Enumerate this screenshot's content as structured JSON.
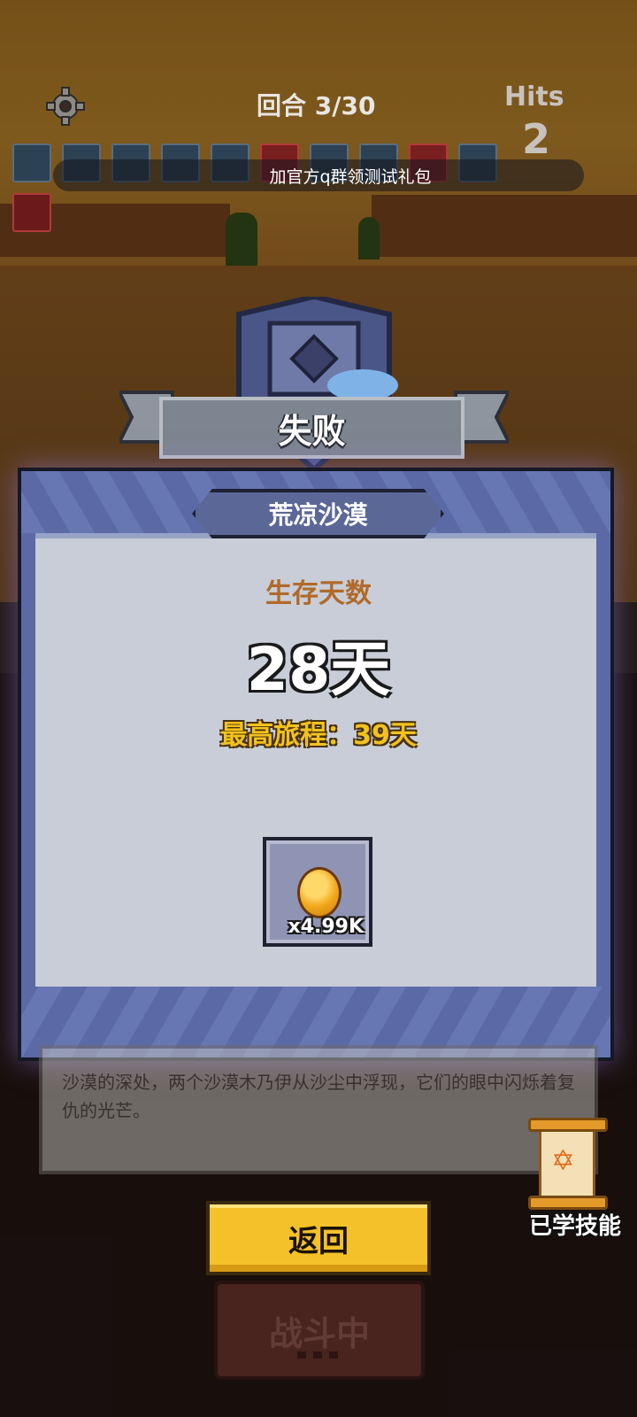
{
  "hud": {
    "round": "回合 3/30",
    "hits_label": "Hits",
    "hits_value": "2",
    "promo_text": "加官方q群领测试礼包"
  },
  "result": {
    "title": "失败",
    "stage_name": "荒凉沙漠",
    "survive_label": "生存天数",
    "survive_days": "28天",
    "best_journey": "最高旅程：39天",
    "reward": {
      "icon": "gold-coin-icon",
      "amount": "x4.99K"
    }
  },
  "story": {
    "text": "沙漠的深处，两个沙漠木乃伊从沙尘中浮现，它们的眼中闪烁着复仇的光芒。"
  },
  "buttons": {
    "back": "返回",
    "fighting": "战斗中",
    "learned_skills": "已学技能"
  },
  "colors": {
    "panel": "#5b6aa6",
    "gold": "#f2c21e",
    "back_button": "#f4c12a",
    "survive_label": "#b06a2a"
  }
}
